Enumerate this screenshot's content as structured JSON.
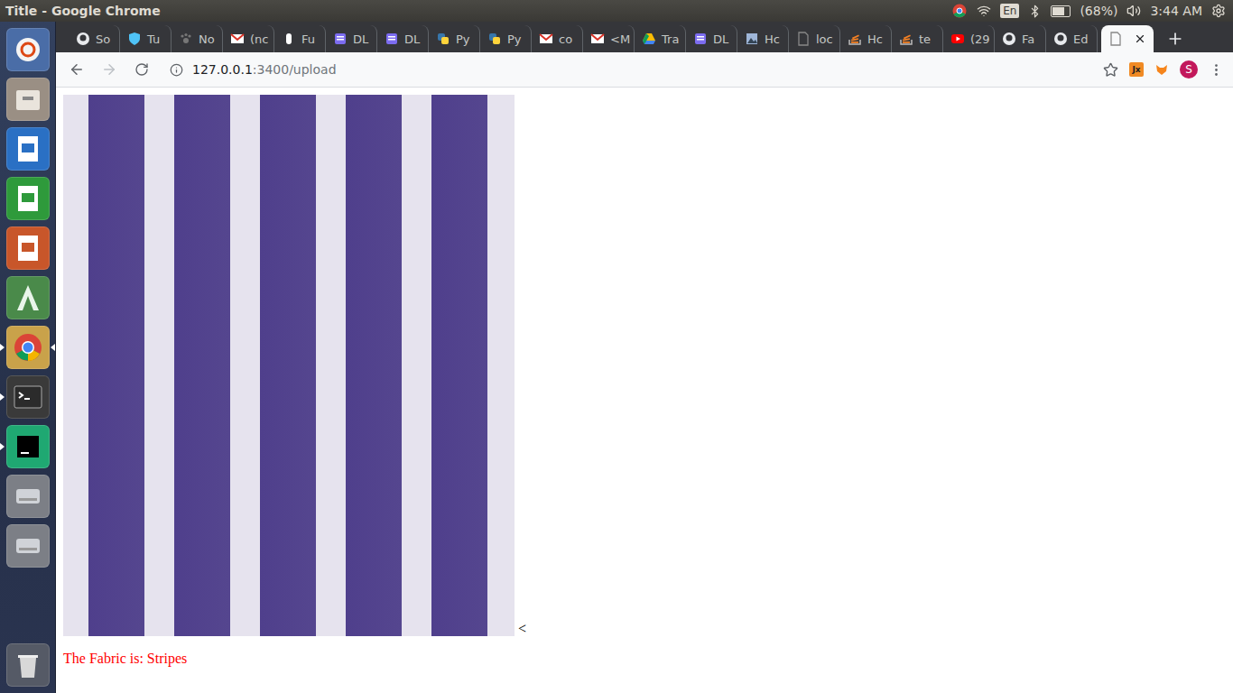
{
  "window": {
    "title": "Title - Google Chrome"
  },
  "tray": {
    "keyboard": "En",
    "battery": "(68%)",
    "battery_level": 0.68,
    "clock": "3:44 AM"
  },
  "launcher": [
    {
      "kind": "ubuntu",
      "running": false,
      "focused": false
    },
    {
      "kind": "files",
      "running": false,
      "focused": false
    },
    {
      "kind": "writer",
      "running": false,
      "focused": false
    },
    {
      "kind": "calc",
      "running": false,
      "focused": false
    },
    {
      "kind": "impress",
      "running": false,
      "focused": false
    },
    {
      "kind": "android",
      "running": false,
      "focused": false
    },
    {
      "kind": "chrome",
      "running": true,
      "focused": true
    },
    {
      "kind": "terminal",
      "running": true,
      "focused": false
    },
    {
      "kind": "pycharm",
      "running": true,
      "focused": false
    },
    {
      "kind": "drive",
      "running": false,
      "focused": false
    },
    {
      "kind": "drive",
      "running": false,
      "focused": false
    }
  ],
  "trash": {
    "kind": "trash"
  },
  "tabs": [
    {
      "label": "So",
      "kind": "github",
      "selected": false
    },
    {
      "label": "Tu",
      "kind": "shield",
      "selected": false
    },
    {
      "label": "No",
      "kind": "paw",
      "selected": false
    },
    {
      "label": "(nc",
      "kind": "gmail",
      "selected": false
    },
    {
      "label": "Fu",
      "kind": "hand",
      "selected": false
    },
    {
      "label": "DL",
      "kind": "doc",
      "selected": false
    },
    {
      "label": "DL",
      "kind": "doc",
      "selected": false
    },
    {
      "label": "Py",
      "kind": "python",
      "selected": false
    },
    {
      "label": "Py",
      "kind": "python",
      "selected": false
    },
    {
      "label": "co",
      "kind": "gmail",
      "selected": false
    },
    {
      "label": "<M",
      "kind": "gmail",
      "selected": false
    },
    {
      "label": "Tra",
      "kind": "drive",
      "selected": false
    },
    {
      "label": "DL",
      "kind": "doc",
      "selected": false
    },
    {
      "label": "Hc",
      "kind": "hub",
      "selected": false
    },
    {
      "label": "loc",
      "kind": "page",
      "selected": false
    },
    {
      "label": "Hc",
      "kind": "stack",
      "selected": false
    },
    {
      "label": "te",
      "kind": "stack",
      "selected": false
    },
    {
      "label": "(29",
      "kind": "youtube",
      "selected": false
    },
    {
      "label": "Fa",
      "kind": "github",
      "selected": false
    },
    {
      "label": "Ed",
      "kind": "github",
      "selected": false
    },
    {
      "label": "",
      "kind": "page",
      "selected": true
    }
  ],
  "address": {
    "host": "127.0.0.1",
    "path": ":3400/upload",
    "back_enabled": true,
    "forward_enabled": false
  },
  "extensions": [
    {
      "label": "Jx",
      "kind": "jx"
    },
    {
      "label": "",
      "kind": "fox"
    }
  ],
  "profile": {
    "initial": "S"
  },
  "page": {
    "caret": "<",
    "result": "The Fabric is: Stripes"
  }
}
